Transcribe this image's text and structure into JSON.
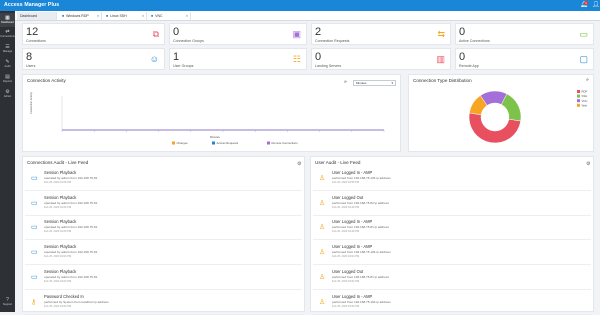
{
  "app": {
    "title": "Access Manager Plus"
  },
  "colors": {
    "primary": "#1a86d8",
    "sidebar": "#2d3035",
    "orange": "#f6a623",
    "red": "#e85060",
    "green": "#7cc24b",
    "purple": "#a46fd8"
  },
  "sidebar": {
    "items": [
      {
        "icon": "dashboard-icon",
        "glyph": "▦",
        "label": "Dashboard"
      },
      {
        "icon": "connections-icon",
        "glyph": "⇄",
        "label": "Connections"
      },
      {
        "icon": "manage-icon",
        "glyph": "☰",
        "label": "Manage"
      },
      {
        "icon": "audit-icon",
        "glyph": "✎",
        "label": "Audit"
      },
      {
        "icon": "reports-icon",
        "glyph": "▤",
        "label": "Reports"
      },
      {
        "icon": "admin-icon",
        "glyph": "⚙",
        "label": "Admin"
      },
      {
        "icon": "support-icon",
        "glyph": "?",
        "label": "Support"
      }
    ]
  },
  "tabs": [
    {
      "label": "Dashboard",
      "icon": ""
    },
    {
      "label": "Windows RDP",
      "icon": "■"
    },
    {
      "label": "Linux SSH",
      "icon": "■"
    },
    {
      "label": "VNC",
      "icon": "■"
    }
  ],
  "stats": [
    {
      "value": "12",
      "label": "Connections",
      "icon": "connections-stat-icon",
      "glyph": "⧉",
      "color": "#e85060"
    },
    {
      "value": "0",
      "label": "Connection Groups",
      "icon": "connection-groups-icon",
      "glyph": "▣",
      "color": "#a46fd8"
    },
    {
      "value": "2",
      "label": "Connection Requests",
      "icon": "requests-icon",
      "glyph": "⇆",
      "color": "#f6a623"
    },
    {
      "value": "0",
      "label": "Active Connections",
      "icon": "active-connections-icon",
      "glyph": "▭",
      "color": "#7cc24b"
    },
    {
      "value": "8",
      "label": "Users",
      "icon": "users-icon",
      "glyph": "☺",
      "color": "#1a86d8"
    },
    {
      "value": "1",
      "label": "User Groups",
      "icon": "user-groups-icon",
      "glyph": "☷",
      "color": "#f6a623"
    },
    {
      "value": "0",
      "label": "Landing Servers",
      "icon": "landing-servers-icon",
      "glyph": "▥",
      "color": "#e85060"
    },
    {
      "value": "0",
      "label": "Remote App",
      "icon": "remote-app-icon",
      "glyph": "▢",
      "color": "#1a86d8"
    }
  ],
  "activity": {
    "title": "Connection Activity",
    "select_value": "Minutes",
    "ylabel": "Connection Activity",
    "xlabel": "Minutes",
    "legend": [
      "Changes",
      "Access Requests",
      "Remote Connections"
    ]
  },
  "distribution": {
    "title": "Connection Type Distribution",
    "legend": [
      "RDP",
      "SSH",
      "VNC",
      "Web"
    ]
  },
  "chart_data": [
    {
      "type": "line",
      "title": "Connection Activity",
      "xlabel": "Minutes",
      "ylabel": "Connection Activity",
      "series": [
        {
          "name": "Changes",
          "values": [
            0,
            0,
            0,
            0,
            0,
            0,
            0,
            0,
            0,
            0,
            0
          ]
        },
        {
          "name": "Access Requests",
          "values": [
            0,
            0,
            0,
            0,
            0,
            0,
            0,
            0,
            0,
            0,
            0
          ]
        },
        {
          "name": "Remote Connections",
          "values": [
            0,
            0,
            0,
            0,
            0,
            0,
            0,
            0,
            0,
            0,
            0
          ]
        }
      ]
    },
    {
      "type": "pie",
      "title": "Connection Type Distribution",
      "categories": [
        "RDP",
        "SSH",
        "VNC",
        "Web"
      ],
      "values": [
        50,
        20,
        17,
        13
      ],
      "colors": [
        "#e85060",
        "#7cc24b",
        "#a46fd8",
        "#f6a623"
      ]
    }
  ],
  "connections_audit": {
    "title": "Connections Audit - Live Feed",
    "rows": [
      {
        "title": "Session Playback",
        "desc": "operated by admin from 192.168.75.81",
        "time": "Feb 25, 2020 04:06 PM",
        "icon": "session-playback-icon",
        "glyph": "▭",
        "color": "#1a86d8"
      },
      {
        "title": "Session Playback",
        "desc": "operated by admin from 192.168.75.81",
        "time": "Feb 25, 2020 04:06 PM",
        "icon": "session-playback-icon",
        "glyph": "▭",
        "color": "#1a86d8"
      },
      {
        "title": "Session Playback",
        "desc": "operated by admin from 192.168.75.81",
        "time": "Feb 25, 2020 04:05 PM",
        "icon": "session-playback-icon",
        "glyph": "▭",
        "color": "#1a86d8"
      },
      {
        "title": "Session Playback",
        "desc": "operated by admin from 192.168.75.81",
        "time": "Feb 25, 2020 04:04 PM",
        "icon": "session-playback-icon",
        "glyph": "▭",
        "color": "#1a86d8"
      },
      {
        "title": "Session Playback",
        "desc": "operated by admin from 192.168.75.81",
        "time": "Feb 25, 2020 04:04 PM",
        "icon": "session-playback-icon",
        "glyph": "▭",
        "color": "#1a86d8"
      },
      {
        "title": "Password Checked In",
        "desc": "performed by System from localhost ip address",
        "time": "Feb 25, 2020 04:00 PM",
        "icon": "password-checkin-icon",
        "glyph": "⚷",
        "color": "#f6a623"
      }
    ]
  },
  "user_audit": {
    "title": "User Audit - Live Feed",
    "rows": [
      {
        "title": "User Logged In - AMP",
        "desc": "performed from 192.168.75.104 ip address",
        "time": "Feb 25, 2020 04:55 PM",
        "icon": "user-login-icon",
        "glyph": "♙",
        "color": "#f6a623"
      },
      {
        "title": "User Logged Out",
        "desc": "performed from 192.168.75.82 ip address",
        "time": "Feb 25, 2020 04:49 PM",
        "icon": "user-logout-icon",
        "glyph": "♙",
        "color": "#f6a623"
      },
      {
        "title": "User Logged In - AMP",
        "desc": "performed from 192.168.75.81 ip address",
        "time": "Feb 25, 2020 04:49 PM",
        "icon": "user-login-icon",
        "glyph": "♙",
        "color": "#f6a623"
      },
      {
        "title": "User Logged In - AMP",
        "desc": "performed from 192.168.75.104 ip address",
        "time": "Feb 25, 2020 04:04 PM",
        "icon": "user-login-icon",
        "glyph": "♙",
        "color": "#f6a623"
      },
      {
        "title": "User Logged Out",
        "desc": "performed from 192.168.75.81 ip address",
        "time": "Feb 25, 2020 03:54 PM",
        "icon": "user-logout-icon",
        "glyph": "♙",
        "color": "#f6a623"
      },
      {
        "title": "User Logged In - AMP",
        "desc": "performed from 192.168.75.104 ip address",
        "time": "Feb 25, 2020 03:53 PM",
        "icon": "user-login-icon",
        "glyph": "♙",
        "color": "#f6a623"
      }
    ]
  }
}
